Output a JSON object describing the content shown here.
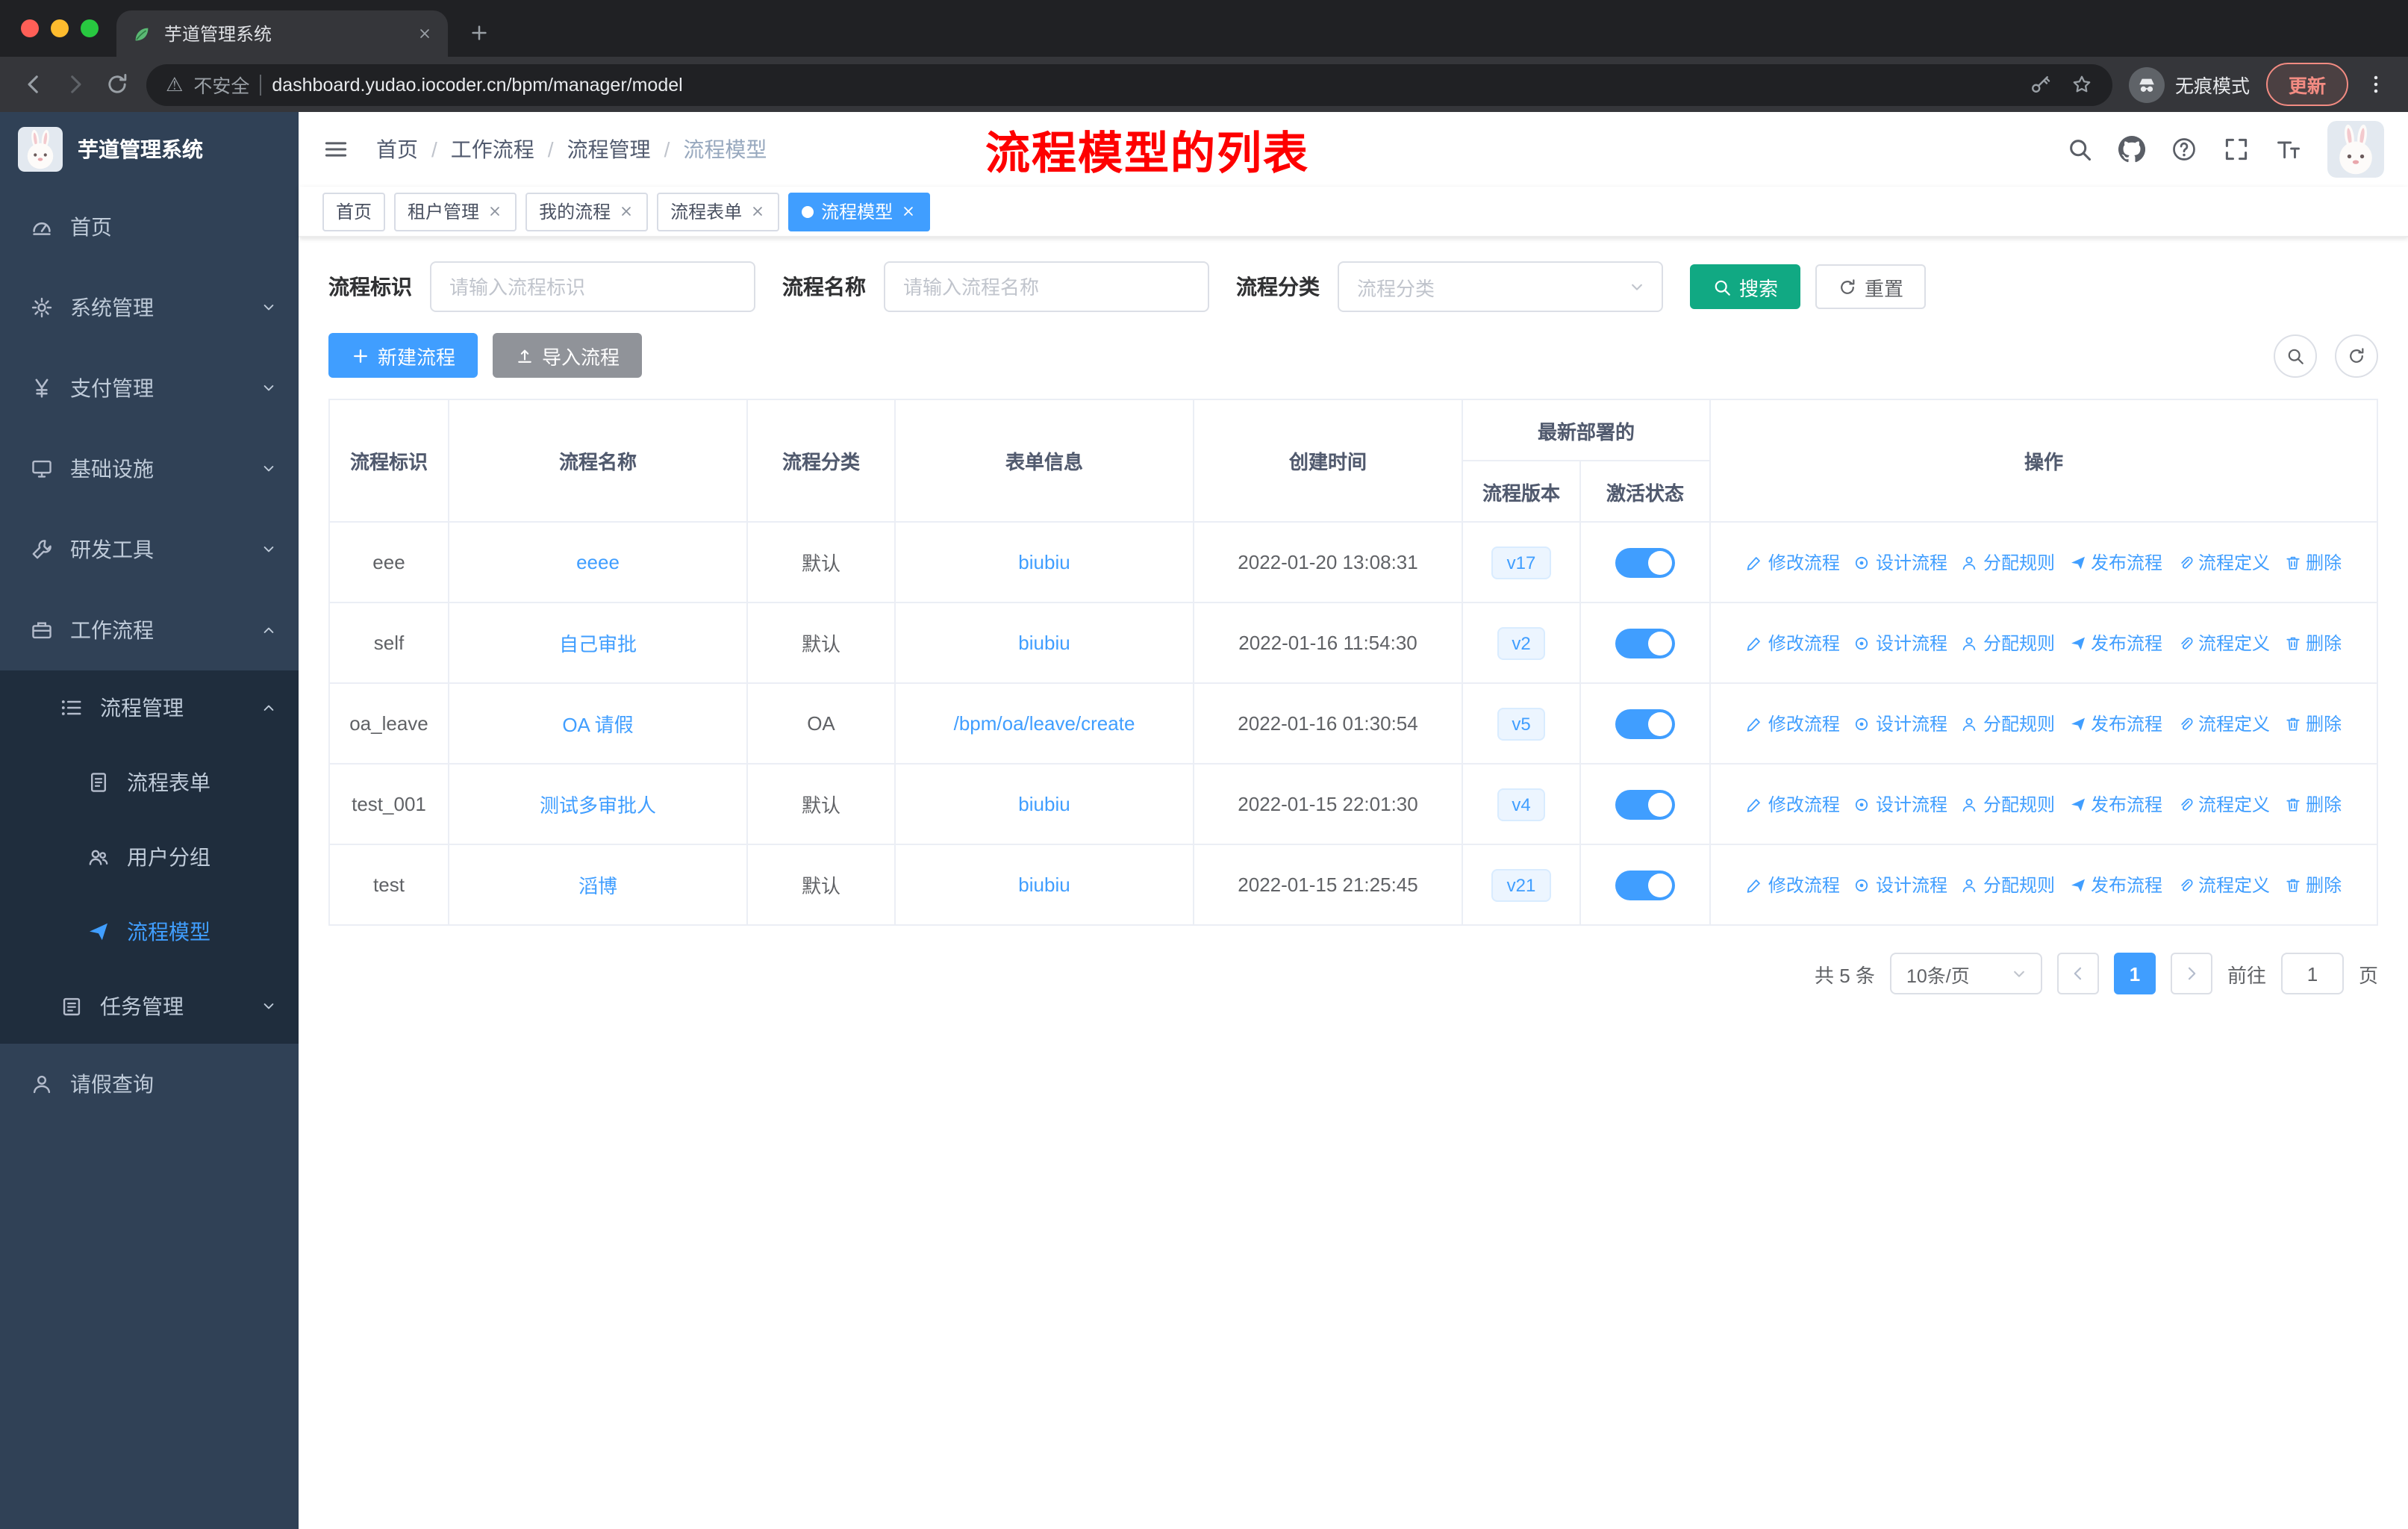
{
  "browser": {
    "tab_title": "芋道管理系统",
    "security_label": "不安全",
    "url": "dashboard.yudao.iocoder.cn/bpm/manager/model",
    "incognito_label": "无痕模式",
    "update_label": "更新"
  },
  "sidebar": {
    "logo_title": "芋道管理系统",
    "items": [
      {
        "label": "首页"
      },
      {
        "label": "系统管理"
      },
      {
        "label": "支付管理"
      },
      {
        "label": "基础设施"
      },
      {
        "label": "研发工具"
      },
      {
        "label": "工作流程"
      },
      {
        "label": "流程管理"
      },
      {
        "label": "流程表单"
      },
      {
        "label": "用户分组"
      },
      {
        "label": "流程模型"
      },
      {
        "label": "任务管理"
      },
      {
        "label": "请假查询"
      }
    ]
  },
  "header": {
    "breadcrumbs": [
      "首页",
      "工作流程",
      "流程管理",
      "流程模型"
    ],
    "separator": "/",
    "annotation": "流程模型的列表",
    "tool_icons": [
      "search-icon",
      "github-icon",
      "help-icon",
      "fullscreen-icon",
      "font-size-icon",
      "avatar"
    ]
  },
  "tabs": [
    {
      "label": "首页",
      "closable": false,
      "active": false
    },
    {
      "label": "租户管理",
      "closable": true,
      "active": false
    },
    {
      "label": "我的流程",
      "closable": true,
      "active": false
    },
    {
      "label": "流程表单",
      "closable": true,
      "active": false
    },
    {
      "label": "流程模型",
      "closable": true,
      "active": true
    }
  ],
  "filters": {
    "key_label": "流程标识",
    "key_placeholder": "请输入流程标识",
    "name_label": "流程名称",
    "name_placeholder": "请输入流程名称",
    "category_label": "流程分类",
    "category_placeholder": "流程分类",
    "search_label": "搜索",
    "reset_label": "重置"
  },
  "toolbar": {
    "create_label": "新建流程",
    "import_label": "导入流程"
  },
  "table": {
    "columns": {
      "key": "流程标识",
      "name": "流程名称",
      "category": "流程分类",
      "form": "表单信息",
      "created": "创建时间",
      "deploy_group": "最新部署的",
      "version": "流程版本",
      "active": "激活状态",
      "actions": "操作"
    },
    "action_labels": [
      "修改流程",
      "设计流程",
      "分配规则",
      "发布流程",
      "流程定义",
      "删除"
    ],
    "rows": [
      {
        "key": "eee",
        "name": "eeee",
        "category": "默认",
        "form": "biubiu",
        "created": "2022-01-20 13:08:31",
        "version": "v17",
        "active": true
      },
      {
        "key": "self",
        "name": "自己审批",
        "category": "默认",
        "form": "biubiu",
        "created": "2022-01-16 11:54:30",
        "version": "v2",
        "active": true
      },
      {
        "key": "oa_leave",
        "name": "OA 请假",
        "category": "OA",
        "form": "/bpm/oa/leave/create",
        "created": "2022-01-16 01:30:54",
        "version": "v5",
        "active": true
      },
      {
        "key": "test_001",
        "name": "测试多审批人",
        "category": "默认",
        "form": "biubiu",
        "created": "2022-01-15 22:01:30",
        "version": "v4",
        "active": true
      },
      {
        "key": "test",
        "name": "滔博",
        "category": "默认",
        "form": "biubiu",
        "created": "2022-01-15 21:25:45",
        "version": "v21",
        "active": true
      }
    ]
  },
  "pagination": {
    "total_label": "共 5 条",
    "page_size": "10条/页",
    "current_page": "1",
    "goto_label": "前往",
    "goto_value": "1",
    "unit_label": "页"
  },
  "colors": {
    "accent": "#409eff",
    "search_button": "#11a983",
    "annotation_red": "#fe0000",
    "sidebar_bg": "#304156",
    "sidebar_submenu_bg": "#1f2d3d"
  }
}
